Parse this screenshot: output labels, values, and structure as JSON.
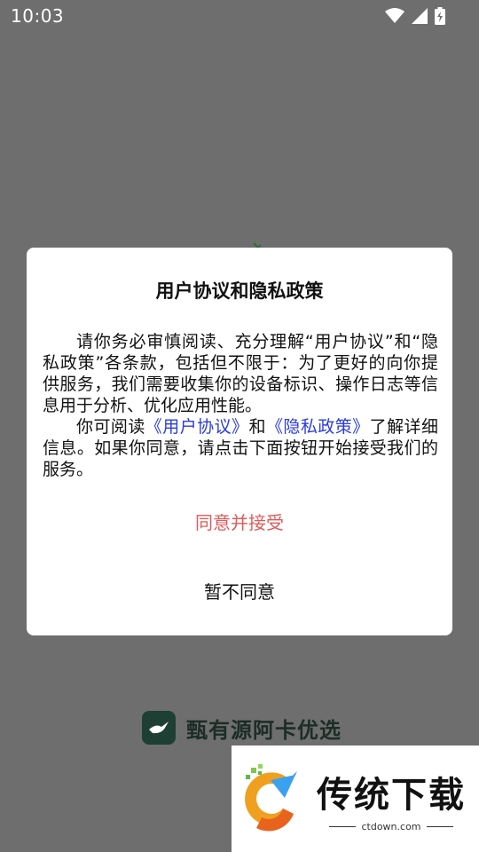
{
  "status_bar": {
    "time": "10:03",
    "icons": [
      "wifi-icon",
      "cellular-signal-icon",
      "battery-charging-icon"
    ]
  },
  "splash": {
    "brand_name": "甄有源阿卡优选",
    "brand_color": "#1e3f33"
  },
  "dialog": {
    "title": "用户协议和隐私政策",
    "paragraph1": "请你务必审慎阅读、充分理解“用户协议”和“隐私政策”各条款，包括但不限于：为了更好的向你提供服务，我们需要收集你的设备标识、操作日志等信息用于分析、优化应用性能。",
    "paragraph2_prefix": "你可阅读",
    "user_agreement_link": "《用户协议》",
    "paragraph2_and": "和",
    "privacy_policy_link": "《隐私政策》",
    "paragraph2_suffix": "了解详细信息。如果你同意，请点击下面按钮开始接受我们的服务。",
    "accept_label": "同意并接受",
    "decline_label": "暂不同意",
    "accent_color": "#e05a5a",
    "link_color": "#2a3ce0"
  },
  "watermark": {
    "title": "传统下载",
    "url": "ctdown.com"
  }
}
